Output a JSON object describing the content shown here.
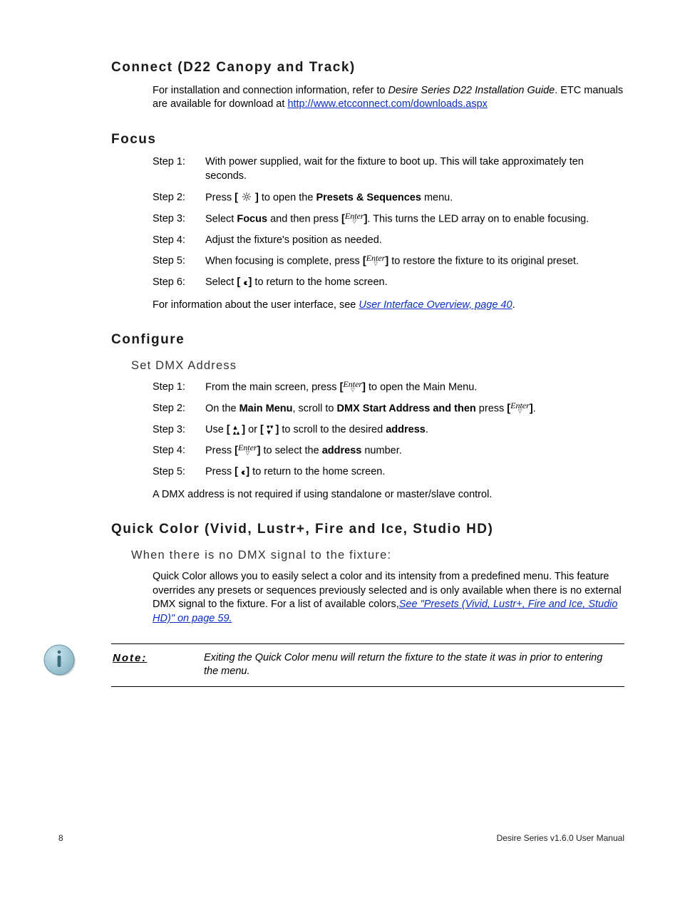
{
  "sections": {
    "connect": {
      "title": "Connect (D22 Canopy and Track)",
      "para1a": "For installation and connection information, refer to ",
      "ital1": "Desire Series D22 Installation Guide",
      "para1b": ". ETC manuals are available for download at ",
      "link1": "http://www.etcconnect.com/downloads.aspx"
    },
    "focus": {
      "title": "Focus",
      "steps": [
        {
          "label": "Step 1:",
          "text": "With power supplied, wait for the fixture to boot up. This will take approximately ten seconds."
        },
        {
          "label": "Step 2:",
          "pre": "Press ",
          "icon": "star",
          "post_a": " to open the ",
          "bold": "Presets & Sequences",
          "post_b": " menu."
        },
        {
          "label": "Step 3:",
          "pre": "Select ",
          "bold1": "Focus",
          "mid": " and then press ",
          "icon": "enter",
          "post": ". This turns the LED array on to enable focusing."
        },
        {
          "label": "Step 4:",
          "text": "Adjust the fixture's position as needed."
        },
        {
          "label": "Step 5:",
          "pre": "When focusing is complete, press ",
          "icon": "enter",
          "post": " to restore the fixture to its original preset."
        },
        {
          "label": "Step 6:",
          "pre": "Select ",
          "icon": "back",
          "post": " to return to the home screen."
        }
      ],
      "info_a": "For information about the user interface, see ",
      "info_link": "User Interface Overview, page 40",
      "info_b": "."
    },
    "configure": {
      "title": "Configure",
      "sub": "Set DMX Address",
      "steps": [
        {
          "label": "Step 1:",
          "pre": "From the main screen, press ",
          "icon": "enter",
          "post": " to open the Main Menu."
        },
        {
          "label": "Step 2:",
          "pre": "On the ",
          "bold1": "Main Menu",
          "mid": ", scroll to ",
          "bold2": "DMX Start Address and then",
          "mid2": " press ",
          "icon": "enter",
          "post": "."
        },
        {
          "label": "Step 3:",
          "pre": "Use ",
          "icon": "up",
          "mid": " or ",
          "icon2": "down",
          "post_a": " to scroll to the desired ",
          "bold": "address",
          "post_b": "."
        },
        {
          "label": "Step 4:",
          "pre": "Press ",
          "icon": "enter",
          "mid": " to select the ",
          "bold": "address",
          "post": " number."
        },
        {
          "label": "Step 5:",
          "pre": "Press ",
          "icon": "back",
          "post": " to return to the home screen."
        }
      ],
      "info": "A DMX address is not required if using standalone or master/slave control."
    },
    "quickcolor": {
      "title": "Quick Color (Vivid, Lustr+, Fire and Ice, Studio HD)",
      "sub": "When there is no DMX signal to the fixture:",
      "para": "Quick Color allows you to easily select a color and its intensity from a predefined menu. This feature overrides any presets or sequences previously selected and is only available when there is no external DMX signal to the fixture. For a list of available colors,",
      "link": "See \"Presets (Vivid, Lustr+, Fire and Ice, Studio HD)\" on page 59.",
      "note_label": "Note:",
      "note_body": "Exiting the Quick Color menu will return the fixture to the state it was in prior to entering the menu."
    }
  },
  "footer": {
    "page": "8",
    "doc": "Desire Series v1.6.0 User Manual"
  }
}
